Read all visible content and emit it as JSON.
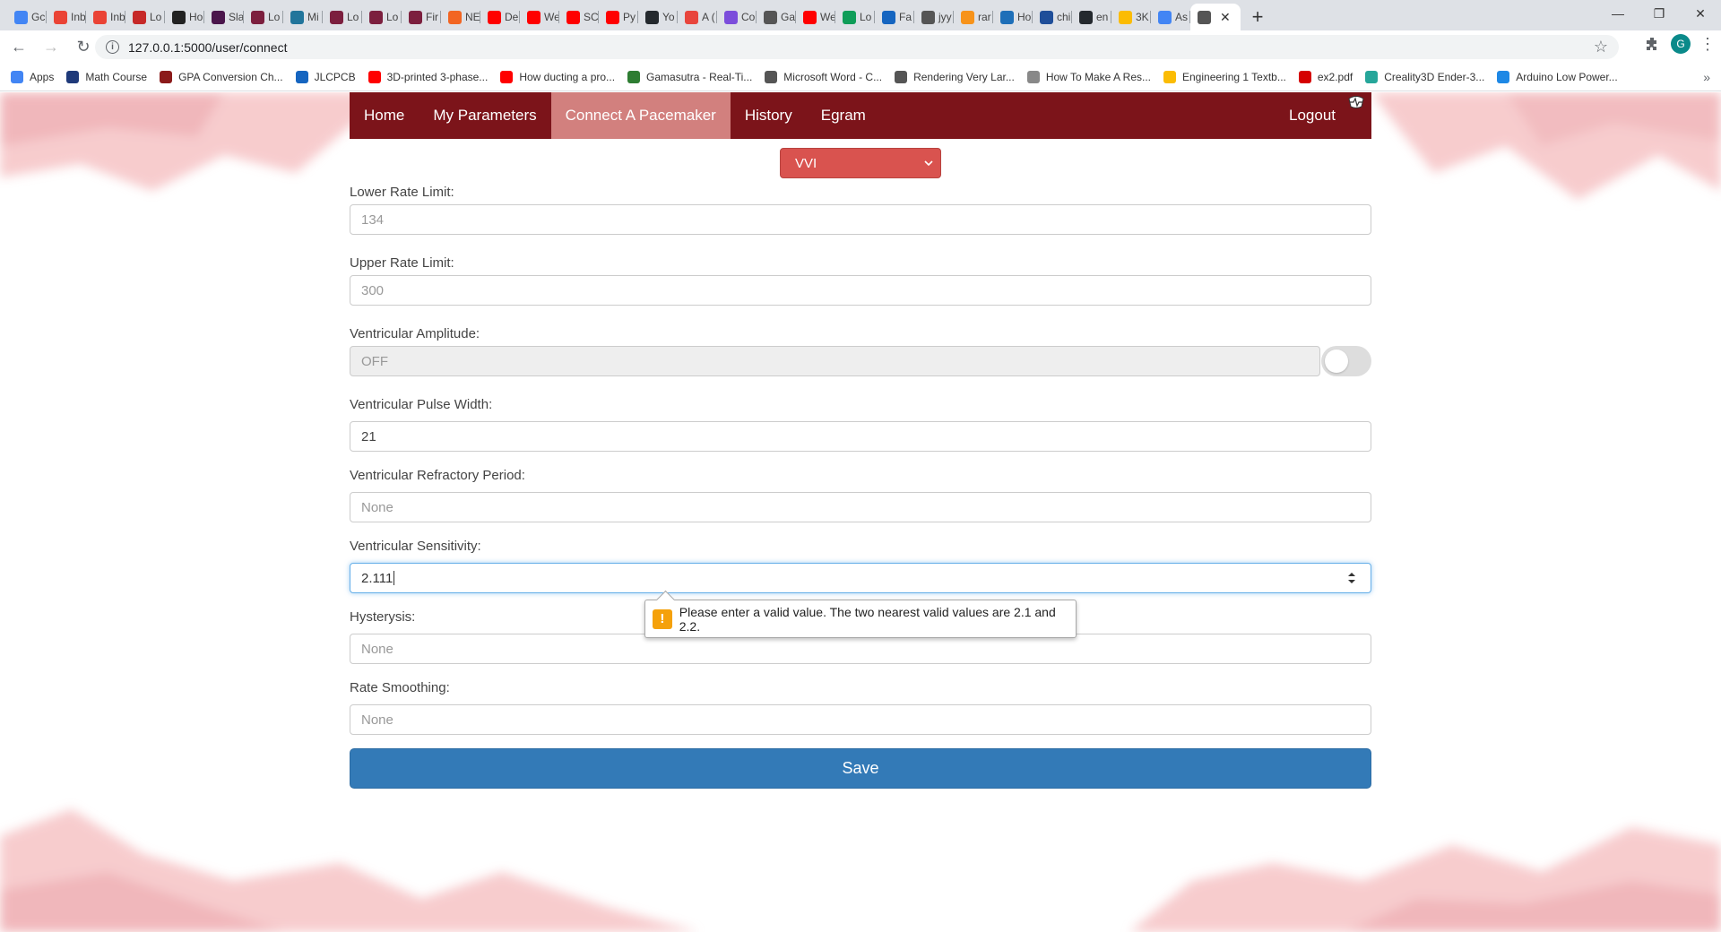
{
  "browser": {
    "tabs": [
      {
        "label": "Gc",
        "icon": "calendar-icon",
        "color": "#4285f4"
      },
      {
        "label": "Inb",
        "icon": "gmail-icon",
        "color": "#ea4335"
      },
      {
        "label": "Inb",
        "icon": "gmail-icon",
        "color": "#ea4335"
      },
      {
        "label": "Lo",
        "icon": "logo-icon",
        "color": "#c62828"
      },
      {
        "label": "Ho",
        "icon": "hex-icon",
        "color": "#222222"
      },
      {
        "label": "Sla",
        "icon": "slack-icon",
        "color": "#4a154b"
      },
      {
        "label": "Lo",
        "icon": "shield-icon",
        "color": "#7c1f3e"
      },
      {
        "label": "Mi",
        "icon": "wordpress-icon",
        "color": "#21759b"
      },
      {
        "label": "Lo",
        "icon": "shield-icon",
        "color": "#7c1f3e"
      },
      {
        "label": "Lo",
        "icon": "shield-icon",
        "color": "#7c1f3e"
      },
      {
        "label": "Fir",
        "icon": "shield-icon",
        "color": "#7c1f3e"
      },
      {
        "label": "NE",
        "icon": "orange-icon",
        "color": "#f26522"
      },
      {
        "label": "De",
        "icon": "youtube-icon",
        "color": "#ff0000"
      },
      {
        "label": "We",
        "icon": "youtube-icon",
        "color": "#ff0000"
      },
      {
        "label": "SC",
        "icon": "youtube-icon",
        "color": "#ff0000"
      },
      {
        "label": "Py",
        "icon": "youtube-icon",
        "color": "#ff0000"
      },
      {
        "label": "Yo",
        "icon": "github-icon",
        "color": "#24292e"
      },
      {
        "label": "A (",
        "icon": "asterisk-icon",
        "color": "#e8453c"
      },
      {
        "label": "Co",
        "icon": "c-icon",
        "color": "#7b4ddb"
      },
      {
        "label": "Ga",
        "icon": "globe-icon",
        "color": "#555555"
      },
      {
        "label": "We",
        "icon": "youtube-icon",
        "color": "#ff0000"
      },
      {
        "label": "Lo",
        "icon": "sheet-icon",
        "color": "#0f9d58"
      },
      {
        "label": "Fa",
        "icon": "book-icon",
        "color": "#1565c0"
      },
      {
        "label": "jyy",
        "icon": "globe-icon",
        "color": "#555555"
      },
      {
        "label": "rar",
        "icon": "bitcoin-icon",
        "color": "#f7931a"
      },
      {
        "label": "Ho",
        "icon": "circle-icon",
        "color": "#1e6fb8"
      },
      {
        "label": "chi",
        "icon": "terminal-icon",
        "color": "#1f4e99"
      },
      {
        "label": "en",
        "icon": "github-icon",
        "color": "#24292e"
      },
      {
        "label": "3K",
        "icon": "drive-icon",
        "color": "#fbbc04"
      },
      {
        "label": "As",
        "icon": "docs-icon",
        "color": "#4285f4"
      },
      {
        "label": "",
        "icon": "globe-icon",
        "color": "#555555",
        "active": true
      }
    ],
    "url": "127.0.0.1:5000/user/connect",
    "profile_initial": "G",
    "bookmarks": [
      {
        "label": "Apps",
        "color": "#4285f4"
      },
      {
        "label": "Math Course",
        "color": "#1f3a7a"
      },
      {
        "label": "GPA Conversion Ch...",
        "color": "#8b1a1a"
      },
      {
        "label": "JLCPCB",
        "color": "#1565c0"
      },
      {
        "label": "3D-printed 3-phase...",
        "color": "#ff0000"
      },
      {
        "label": "How ducting a pro...",
        "color": "#ff0000"
      },
      {
        "label": "Gamasutra - Real-Ti...",
        "color": "#2e7d32"
      },
      {
        "label": "Microsoft Word - C...",
        "color": "#555555"
      },
      {
        "label": "Rendering Very Lar...",
        "color": "#555555"
      },
      {
        "label": "How To Make A Res...",
        "color": "#888888"
      },
      {
        "label": "Engineering 1 Textb...",
        "color": "#fbbc04"
      },
      {
        "label": "ex2.pdf",
        "color": "#d50000"
      },
      {
        "label": "Creality3D Ender-3...",
        "color": "#26a69a"
      },
      {
        "label": "Arduino Low Power...",
        "color": "#1e88e5"
      }
    ]
  },
  "nav": {
    "items": [
      "Home",
      "My Parameters",
      "Connect A Pacemaker",
      "History",
      "Egram"
    ],
    "logout": "Logout",
    "color": "#7c141a",
    "active_color": "#d2807e"
  },
  "mode_select": {
    "value": "VVI",
    "color": "#d9534f"
  },
  "fields": {
    "lower_rate": {
      "label": "Lower Rate Limit:",
      "value": "134"
    },
    "upper_rate": {
      "label": "Upper Rate Limit:",
      "value": "300"
    },
    "v_amplitude": {
      "label": "Ventricular Amplitude:",
      "value": "OFF"
    },
    "v_pulse_width": {
      "label": "Ventricular Pulse Width:",
      "value": "21"
    },
    "v_refractory": {
      "label": "Ventricular Refractory Period:",
      "placeholder": "None"
    },
    "v_sensitivity": {
      "label": "Ventricular Sensitivity:",
      "value": "2.111"
    },
    "hysteresis": {
      "label": "Hysterysis:",
      "placeholder": "None"
    },
    "rate_smoothing": {
      "label": "Rate Smoothing:",
      "placeholder": "None"
    }
  },
  "validation": {
    "message": "Please enter a valid value. The two nearest valid values are 2.1 and 2.2."
  },
  "save": {
    "label": "Save",
    "color": "#337ab7"
  }
}
